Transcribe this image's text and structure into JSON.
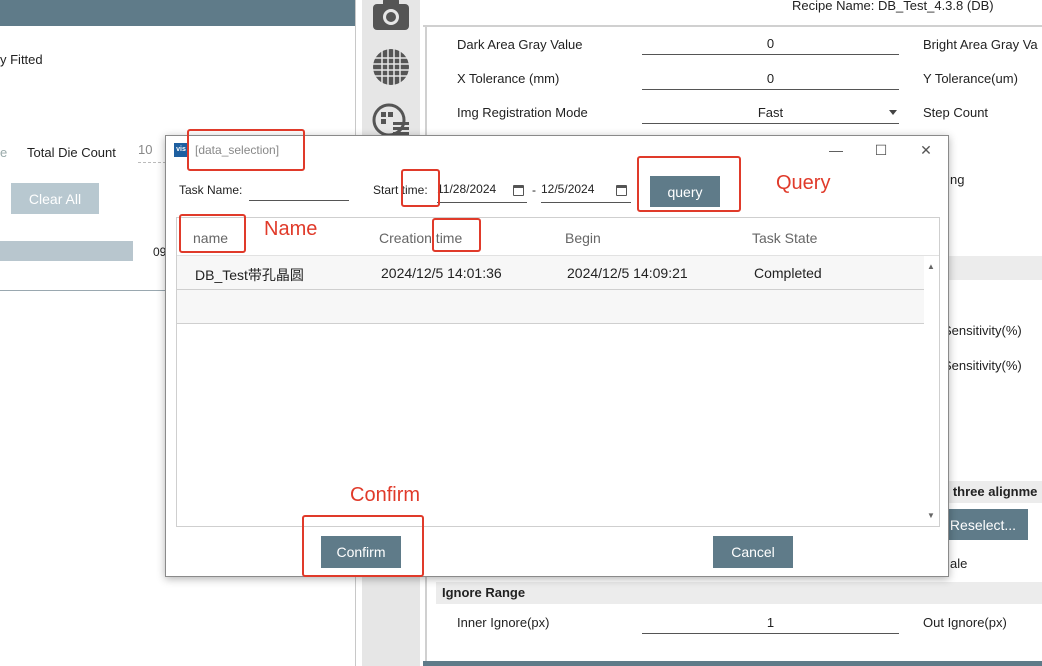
{
  "background": {
    "left": {
      "fitted_text": "y Fitted",
      "e_text": "e",
      "total_die_count_label": "Total Die Count",
      "total_die_count_value": "10",
      "clear_all": "Clear All",
      "progress_text": "09"
    },
    "right": {
      "recipe_name": "Recipe Name: DB_Test_4.3.8 (DB)",
      "rows": [
        {
          "label": "Dark Area Gray Value",
          "value": "0",
          "right_label": "Bright Area Gray Va"
        },
        {
          "label": "X Tolerance (mm)",
          "value": "0",
          "right_label": "Y Tolerance(um)"
        },
        {
          "label": "Img Registration Mode",
          "value": "Fast",
          "right_label": "Step Count"
        }
      ],
      "partial_ng": "ng",
      "sensitivity_1": "Sensitivity(%)",
      "sensitivity_2": "Sensitivity(%)",
      "three_align": "e three alignme",
      "reselect": "Reselect...",
      "ale_text": "ale",
      "ignore_range_title": "Ignore Range",
      "inner_ignore_label": "Inner Ignore(px)",
      "inner_ignore_value": "1",
      "out_ignore_label": "Out Ignore(px)"
    }
  },
  "dialog": {
    "logo_text": "vis",
    "title": "[data_selection]",
    "task_name_label": "Task Name:",
    "task_name_value": "",
    "start_time_label": "Start time:",
    "date_from": "11/28/2024",
    "date_sep": "-",
    "date_to": "12/5/2024",
    "query_label": "query",
    "columns": [
      "name",
      "Creation time",
      "Begin",
      "Task State"
    ],
    "rows": [
      {
        "name": "DB_Test带孔晶圆",
        "creation_time": "2024/12/5 14:01:36",
        "begin": "2024/12/5 14:09:21",
        "task_state": "Completed"
      }
    ],
    "confirm_label": "Confirm",
    "cancel_label": "Cancel"
  },
  "annotations": {
    "query": "Query",
    "name": "Name",
    "confirm": "Confirm"
  },
  "colors": {
    "accent": "#5f7b89",
    "annotation": "#e03a2a"
  }
}
